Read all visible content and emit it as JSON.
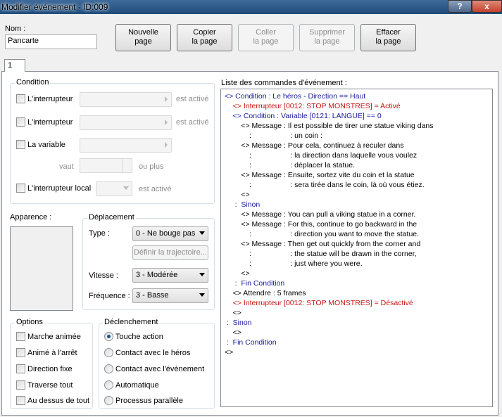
{
  "window": {
    "title": "Modifier événement - ID:009",
    "help_label": "?",
    "close_label": "x"
  },
  "name": {
    "label": "Nom :",
    "value": "Pancarte"
  },
  "toolbar": {
    "new_page": "Nouvelle\npage",
    "copy_page": "Copier\nla page",
    "paste_page": "Coller\nla page",
    "delete_page": "Supprimer\nla page",
    "clear_page": "Effacer\nla page"
  },
  "tabs": [
    "1"
  ],
  "condition": {
    "title": "Condition",
    "switch1_label": "L'interrupteur",
    "switch1_suffix": "est activé",
    "switch2_label": "L'interrupteur",
    "switch2_suffix": "est activé",
    "variable_label": "La variable",
    "value_label": "vaut",
    "value_suffix": "ou plus",
    "local_switch_label": "L'interrupteur local",
    "local_switch_suffix": "est activé"
  },
  "appearance": {
    "title": "Apparence :"
  },
  "movement": {
    "title": "Déplacement",
    "type_label": "Type :",
    "type_value": "0 - Ne bouge pas",
    "route_button": "Définir la trajectoire...",
    "speed_label": "Vitesse :",
    "speed_value": "3 - Modérée",
    "freq_label": "Fréquence :",
    "freq_value": "3 - Basse"
  },
  "options": {
    "title": "Options",
    "items": [
      "Marche animée",
      "Animé à l'arrêt",
      "Direction fixe",
      "Traverse tout",
      "Au dessus de tout"
    ]
  },
  "trigger": {
    "title": "Déclenchement",
    "items": [
      "Touche action",
      "Contact avec le héros",
      "Contact avec l'événement",
      "Automatique",
      "Processus parallèle"
    ],
    "selected": "Touche action"
  },
  "commands": {
    "title": "Liste des commandes d'événement :",
    "lines": [
      {
        "indent": "",
        "text": "<> Condition : Le héros - Direction == Haut",
        "color": "blue"
      },
      {
        "indent": "    ",
        "text": "<> Interrupteur [0012: STOP MONSTRES] = Activé",
        "color": "red"
      },
      {
        "indent": "    ",
        "text": "<> Condition : Variable [0121: LANGUE] == 0",
        "color": "blue"
      },
      {
        "indent": "        ",
        "text": "<> Message : Il est possible de tirer une statue viking dans",
        "color": "black"
      },
      {
        "indent": "        ",
        "text": "    :                   : un coin :",
        "color": "black"
      },
      {
        "indent": "        ",
        "text": "<> Message : Pour cela, continuez à reculer dans",
        "color": "black"
      },
      {
        "indent": "        ",
        "text": "    :                   : la direction dans laquelle vous voulez",
        "color": "black"
      },
      {
        "indent": "        ",
        "text": "    :                   : déplacer la statue.",
        "color": "black"
      },
      {
        "indent": "        ",
        "text": "<> Message : Ensuite, sortez vite du coin et la statue",
        "color": "black"
      },
      {
        "indent": "        ",
        "text": "    :                   : sera tirée dans le coin, là où vous étiez.",
        "color": "black"
      },
      {
        "indent": "        ",
        "text": "<>",
        "color": "black"
      },
      {
        "indent": "    ",
        "text": " :  Sinon",
        "color": "blue"
      },
      {
        "indent": "        ",
        "text": "<> Message : You can pull a viking statue in a corner.",
        "color": "black"
      },
      {
        "indent": "        ",
        "text": "<> Message : For this, continue to go backward in the",
        "color": "black"
      },
      {
        "indent": "        ",
        "text": "    :                   : direction you want to move the statue.",
        "color": "black"
      },
      {
        "indent": "        ",
        "text": "<> Message : Then get out quickly from the corner and",
        "color": "black"
      },
      {
        "indent": "        ",
        "text": "    :                   : the statue will be drawn in the corner,",
        "color": "black"
      },
      {
        "indent": "        ",
        "text": "    :                   : just where you were.",
        "color": "black"
      },
      {
        "indent": "        ",
        "text": "<>",
        "color": "black"
      },
      {
        "indent": "    ",
        "text": " :  Fin Condition",
        "color": "blue"
      },
      {
        "indent": "    ",
        "text": "<> Attendre : 5 frames",
        "color": "black"
      },
      {
        "indent": "    ",
        "text": "<> Interrupteur [0012: STOP MONSTRES] = Désactivé",
        "color": "red"
      },
      {
        "indent": "    ",
        "text": "<>",
        "color": "black"
      },
      {
        "indent": "",
        "text": " :  Sinon",
        "color": "blue"
      },
      {
        "indent": "    ",
        "text": "<>",
        "color": "black"
      },
      {
        "indent": "",
        "text": " :  Fin Condition",
        "color": "blue"
      },
      {
        "indent": "",
        "text": "<>",
        "color": "black"
      }
    ]
  }
}
